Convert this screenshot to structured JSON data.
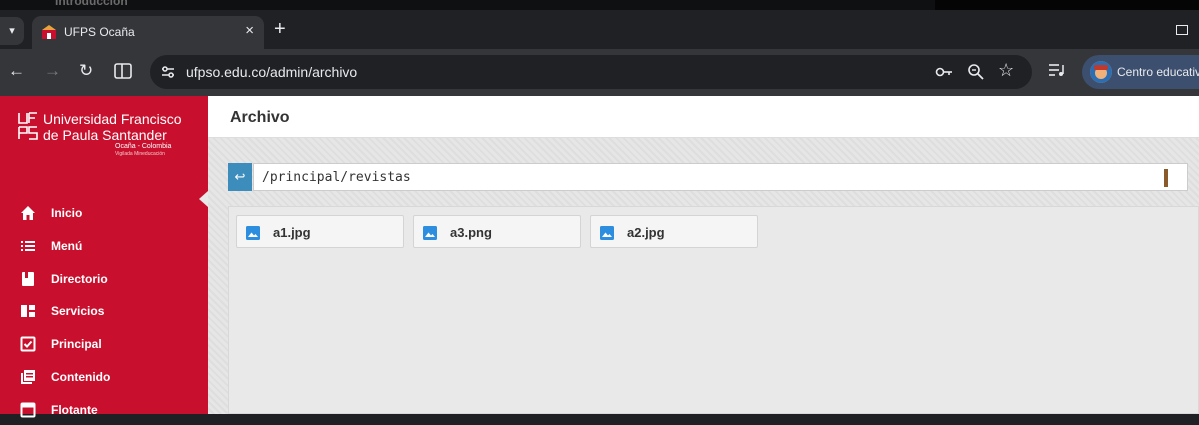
{
  "browser": {
    "peek_text": "Introducción",
    "tab": {
      "title": "UFPS Ocaña",
      "favicon": "university-favicon"
    },
    "address": {
      "url": "ufpso.edu.co/admin/archivo"
    },
    "profile": {
      "label": "Centro educativ"
    },
    "icons": [
      "tab-search-icon",
      "close-icon",
      "plus-icon",
      "back-icon",
      "forward-icon",
      "reload-icon",
      "split-view-icon",
      "site-info-icon",
      "key-icon",
      "zoom-icon",
      "star-icon",
      "media-queue-icon"
    ]
  },
  "sidebar": {
    "logo": {
      "line1": "Universidad Francisco",
      "line2": "de Paula Santander",
      "line3": "Ocaña - Colombia",
      "line4": "Vigilada Mineducación"
    },
    "items": [
      {
        "label": "Inicio",
        "icon": "home-icon"
      },
      {
        "label": "Menú",
        "icon": "list-icon"
      },
      {
        "label": "Directorio",
        "icon": "book-icon"
      },
      {
        "label": "Servicios",
        "icon": "dashboard-icon"
      },
      {
        "label": "Principal",
        "icon": "checkbox-icon"
      },
      {
        "label": "Contenido",
        "icon": "library-icon"
      },
      {
        "label": "Flotante",
        "icon": "window-icon"
      }
    ]
  },
  "main": {
    "title": "Archivo",
    "path": "/principal/revistas",
    "files": [
      {
        "name": "a1.jpg",
        "icon": "image-icon"
      },
      {
        "name": "a3.png",
        "icon": "image-icon"
      },
      {
        "name": "a2.jpg",
        "icon": "image-icon"
      }
    ]
  },
  "colors": {
    "brand_red": "#c8102e",
    "accent_blue": "#3c8dbc",
    "file_icon_blue": "#2d8ee0"
  }
}
